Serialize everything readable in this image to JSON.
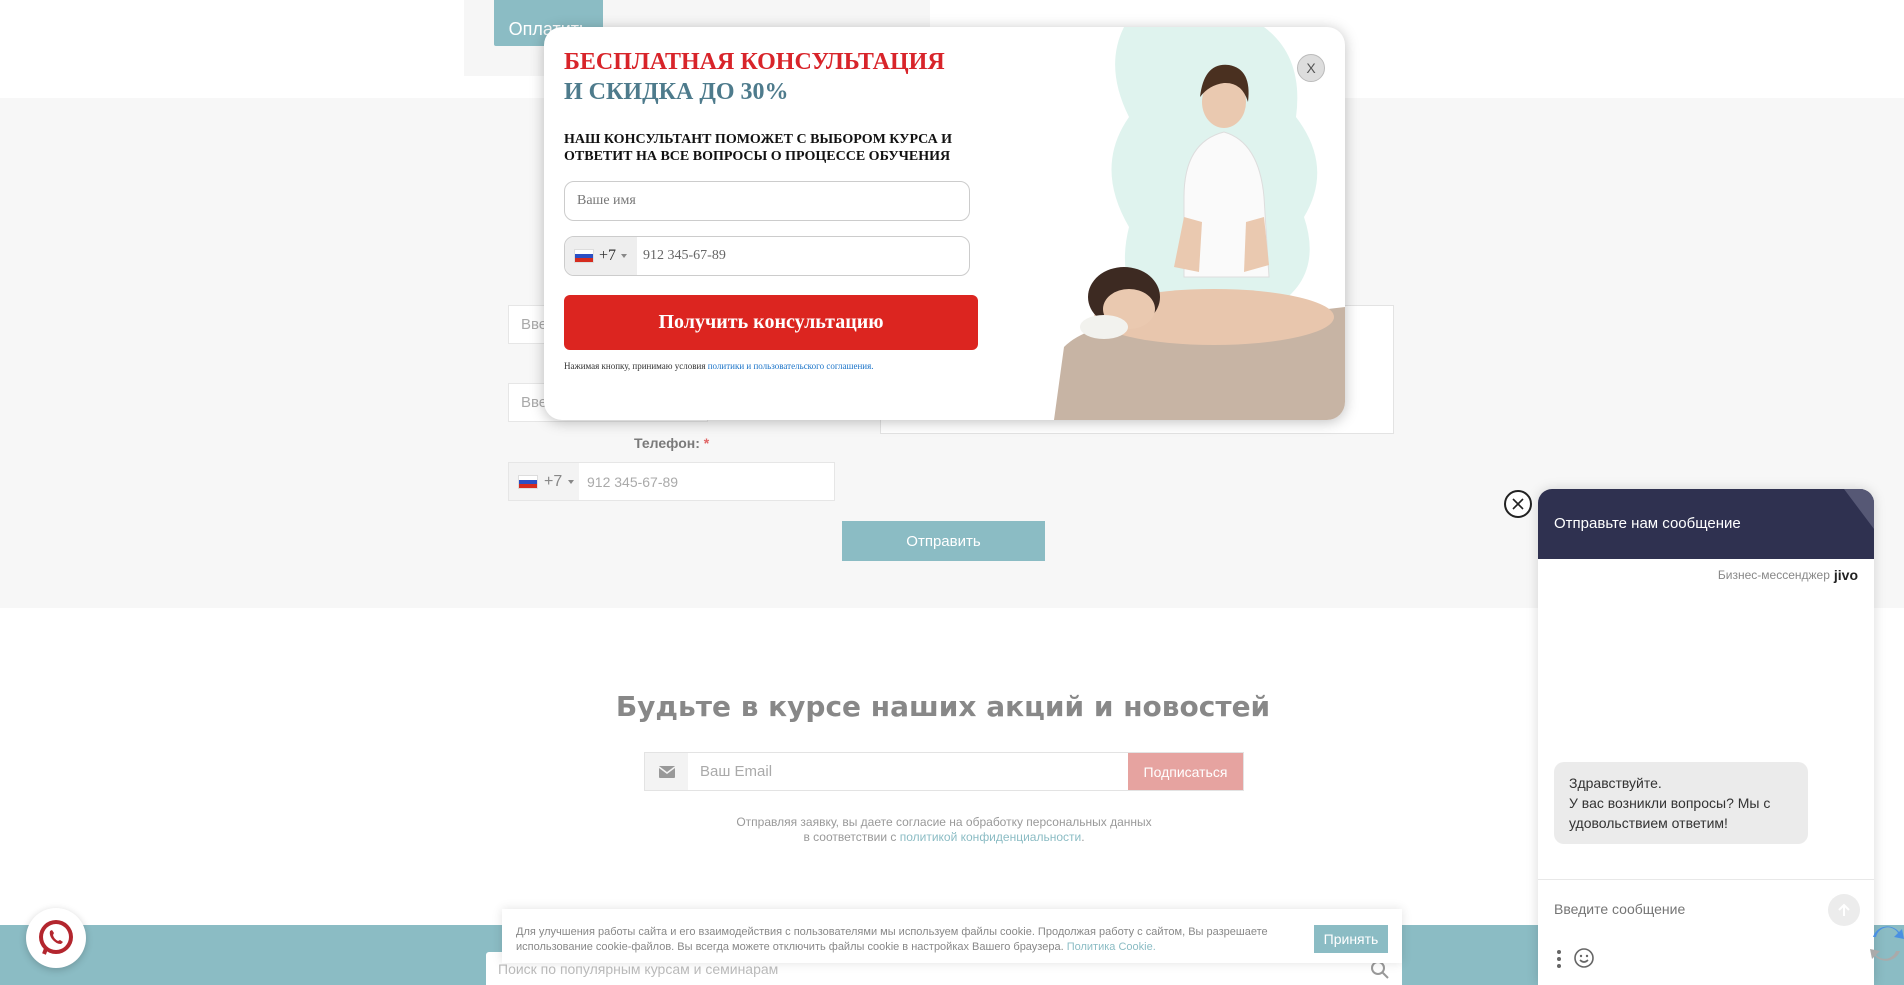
{
  "background": {
    "pay_button": "Оплатить",
    "name_placeholder": "Вве",
    "email_placeholder": "Вве",
    "phone_label": "Телефон:",
    "phone_required_mark": "*",
    "phone_code": "+7",
    "phone_placeholder": "912 345-67-89",
    "send_button": "Отправить"
  },
  "newsletter": {
    "title": "Будьте в курсе наших акций и новостей",
    "email_placeholder": "Ваш Email",
    "subscribe_button": "Подписаться",
    "consent_line1": "Отправляя заявку, вы даете согласие на обработку персональных данных",
    "consent_line2_prefix": "в соответствии с",
    "consent_link": "политикой конфиденциальности",
    "consent_line2_suffix": "."
  },
  "footer": {
    "search_placeholder": "Поиск по популярным курсам и семинарам"
  },
  "cookie": {
    "text": "Для улучшения работы сайта и его взаимодействия с пользователями мы используем файлы cookie. Продолжая работу с сайтом, Вы разрешаете использование cookie-файлов. Вы всегда можете отключить файлы cookie в настройках Вашего браузера.",
    "link": "Политика Cookie.",
    "accept_button": "Принять"
  },
  "popup": {
    "title_line1": "БЕСПЛАТНАЯ КОНСУЛЬТАЦИЯ",
    "title_line2": "И СКИДКА ДО 30%",
    "description": "НАШ КОНСУЛЬТАНТ ПОМОЖЕТ С ВЫБОРОМ КУРСА И ОТВЕТИТ НА ВСЕ ВОПРОСЫ О ПРОЦЕССЕ ОБУЧЕНИЯ",
    "name_placeholder": "Ваше имя",
    "phone_code": "+7",
    "phone_placeholder": "912 345-67-89",
    "submit_button": "Получить консультацию",
    "terms_prefix": "Нажимая кнопку, принимаю условия",
    "terms_link": "политики и пользовательского соглашения.",
    "close_label": "X"
  },
  "chat": {
    "header_title": "Отправьте нам сообщение",
    "brand_label": "Бизнес-мессенджер",
    "brand_name": "jivo",
    "greeting_line1": "Здравствуйте.",
    "greeting_line2": "У вас возникли вопросы? Мы с удовольствием ответим!",
    "message_placeholder": "Введите сообщение"
  },
  "colors": {
    "accent_teal": "#8bbcc4",
    "popup_red": "#dc2520",
    "popup_title_blue": "#4e7b8c",
    "chat_header": "#2f3150",
    "subscribe_pink": "#e6a3a0"
  },
  "icons": [
    "whatsapp-icon",
    "close-icon",
    "envelope-icon",
    "search-icon",
    "send-arrow-icon",
    "more-vertical-icon",
    "smile-icon",
    "recaptcha-icon",
    "russia-flag-icon"
  ]
}
